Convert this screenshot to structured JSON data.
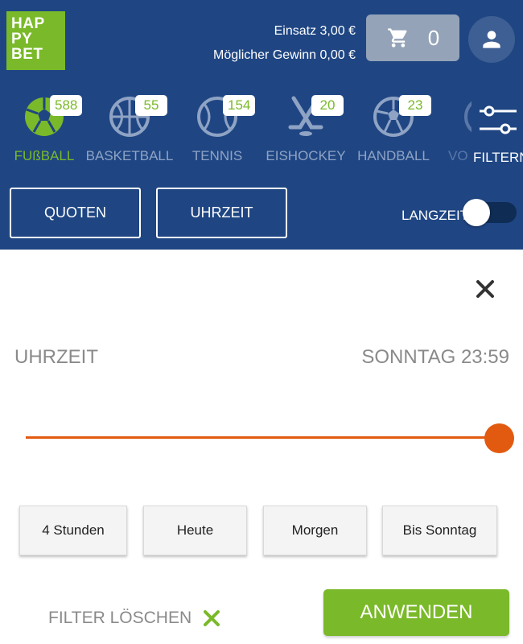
{
  "brand": {
    "logo_lines": [
      "HAP",
      "PY",
      "BET"
    ],
    "accent": "#7ab929",
    "header_bg": "#1f4683"
  },
  "betslip": {
    "stake": "Einsatz 3,00 €",
    "possible_win": "Möglicher Gewinn 0,00 €",
    "cart_count": "0"
  },
  "sports": [
    {
      "label": "FUßBALL",
      "count": "588",
      "icon": "soccer-ball-icon",
      "active": true
    },
    {
      "label": "BASKETBALL",
      "count": "55",
      "icon": "basketball-icon"
    },
    {
      "label": "TENNIS",
      "count": "154",
      "icon": "tennis-ball-icon"
    },
    {
      "label": "EISHOCKEY",
      "count": "20",
      "icon": "hockey-sticks-icon"
    },
    {
      "label": "HANDBALL",
      "count": "23",
      "icon": "handball-icon"
    },
    {
      "label": "VO",
      "icon": "volleyball-icon"
    }
  ],
  "filter_label": "FILTERN",
  "sort": {
    "odds": "QUOTEN",
    "time": "UHRZEIT"
  },
  "langzeit": {
    "label": "LANGZEIT",
    "on": false
  },
  "panel": {
    "time_label": "UHRZEIT",
    "time_value": "SONNTAG 23:59",
    "slider_value_percent": 100,
    "slider_color": "#e25a0f",
    "quick_options": [
      "4 Stunden",
      "Heute",
      "Morgen",
      "Bis Sonntag"
    ],
    "clear_label": "FILTER LÖSCHEN",
    "apply_label": "ANWENDEN"
  }
}
